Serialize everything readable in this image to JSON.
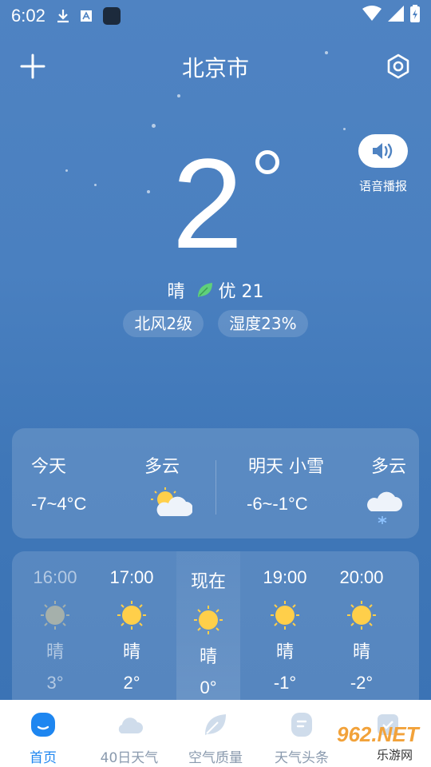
{
  "status": {
    "time": "6:02"
  },
  "header": {
    "city": "北京市"
  },
  "voice": {
    "label": "语音播报"
  },
  "current": {
    "temp": "2",
    "condition": "晴",
    "aqi_label": "优 21",
    "wind": "北风2级",
    "humidity": "湿度23%"
  },
  "days": [
    {
      "name": "今天",
      "condition": "多云",
      "range": "-7~4°C",
      "icon": "partly-cloudy-icon"
    },
    {
      "name": "明天  小雪",
      "condition": "多云",
      "range": "-6~-1°C",
      "icon": "snow-cloud-icon"
    }
  ],
  "hours": [
    {
      "time": "16:00",
      "condition": "晴",
      "temp": "3°",
      "state": "past"
    },
    {
      "time": "17:00",
      "condition": "晴",
      "temp": "2°",
      "state": "future"
    },
    {
      "time": "现在",
      "condition": "晴",
      "temp": "0°",
      "state": "now"
    },
    {
      "time": "19:00",
      "condition": "晴",
      "temp": "-1°",
      "state": "future"
    },
    {
      "time": "20:00",
      "condition": "晴",
      "temp": "-2°",
      "state": "future"
    }
  ],
  "tabs": [
    {
      "label": "首页",
      "icon": "home-icon",
      "active": true
    },
    {
      "label": "40日天气",
      "icon": "cloud-icon",
      "active": false
    },
    {
      "label": "空气质量",
      "icon": "leaf-icon",
      "active": false
    },
    {
      "label": "天气头条",
      "icon": "news-icon",
      "active": false
    },
    {
      "label": "",
      "icon": "calendar-icon",
      "active": false
    }
  ],
  "watermark": {
    "brand": "962.NET",
    "sub": "乐游网"
  },
  "colors": {
    "accent": "#1e86f0",
    "leaf": "#5fd07a",
    "sun": "#ffcf4a"
  }
}
